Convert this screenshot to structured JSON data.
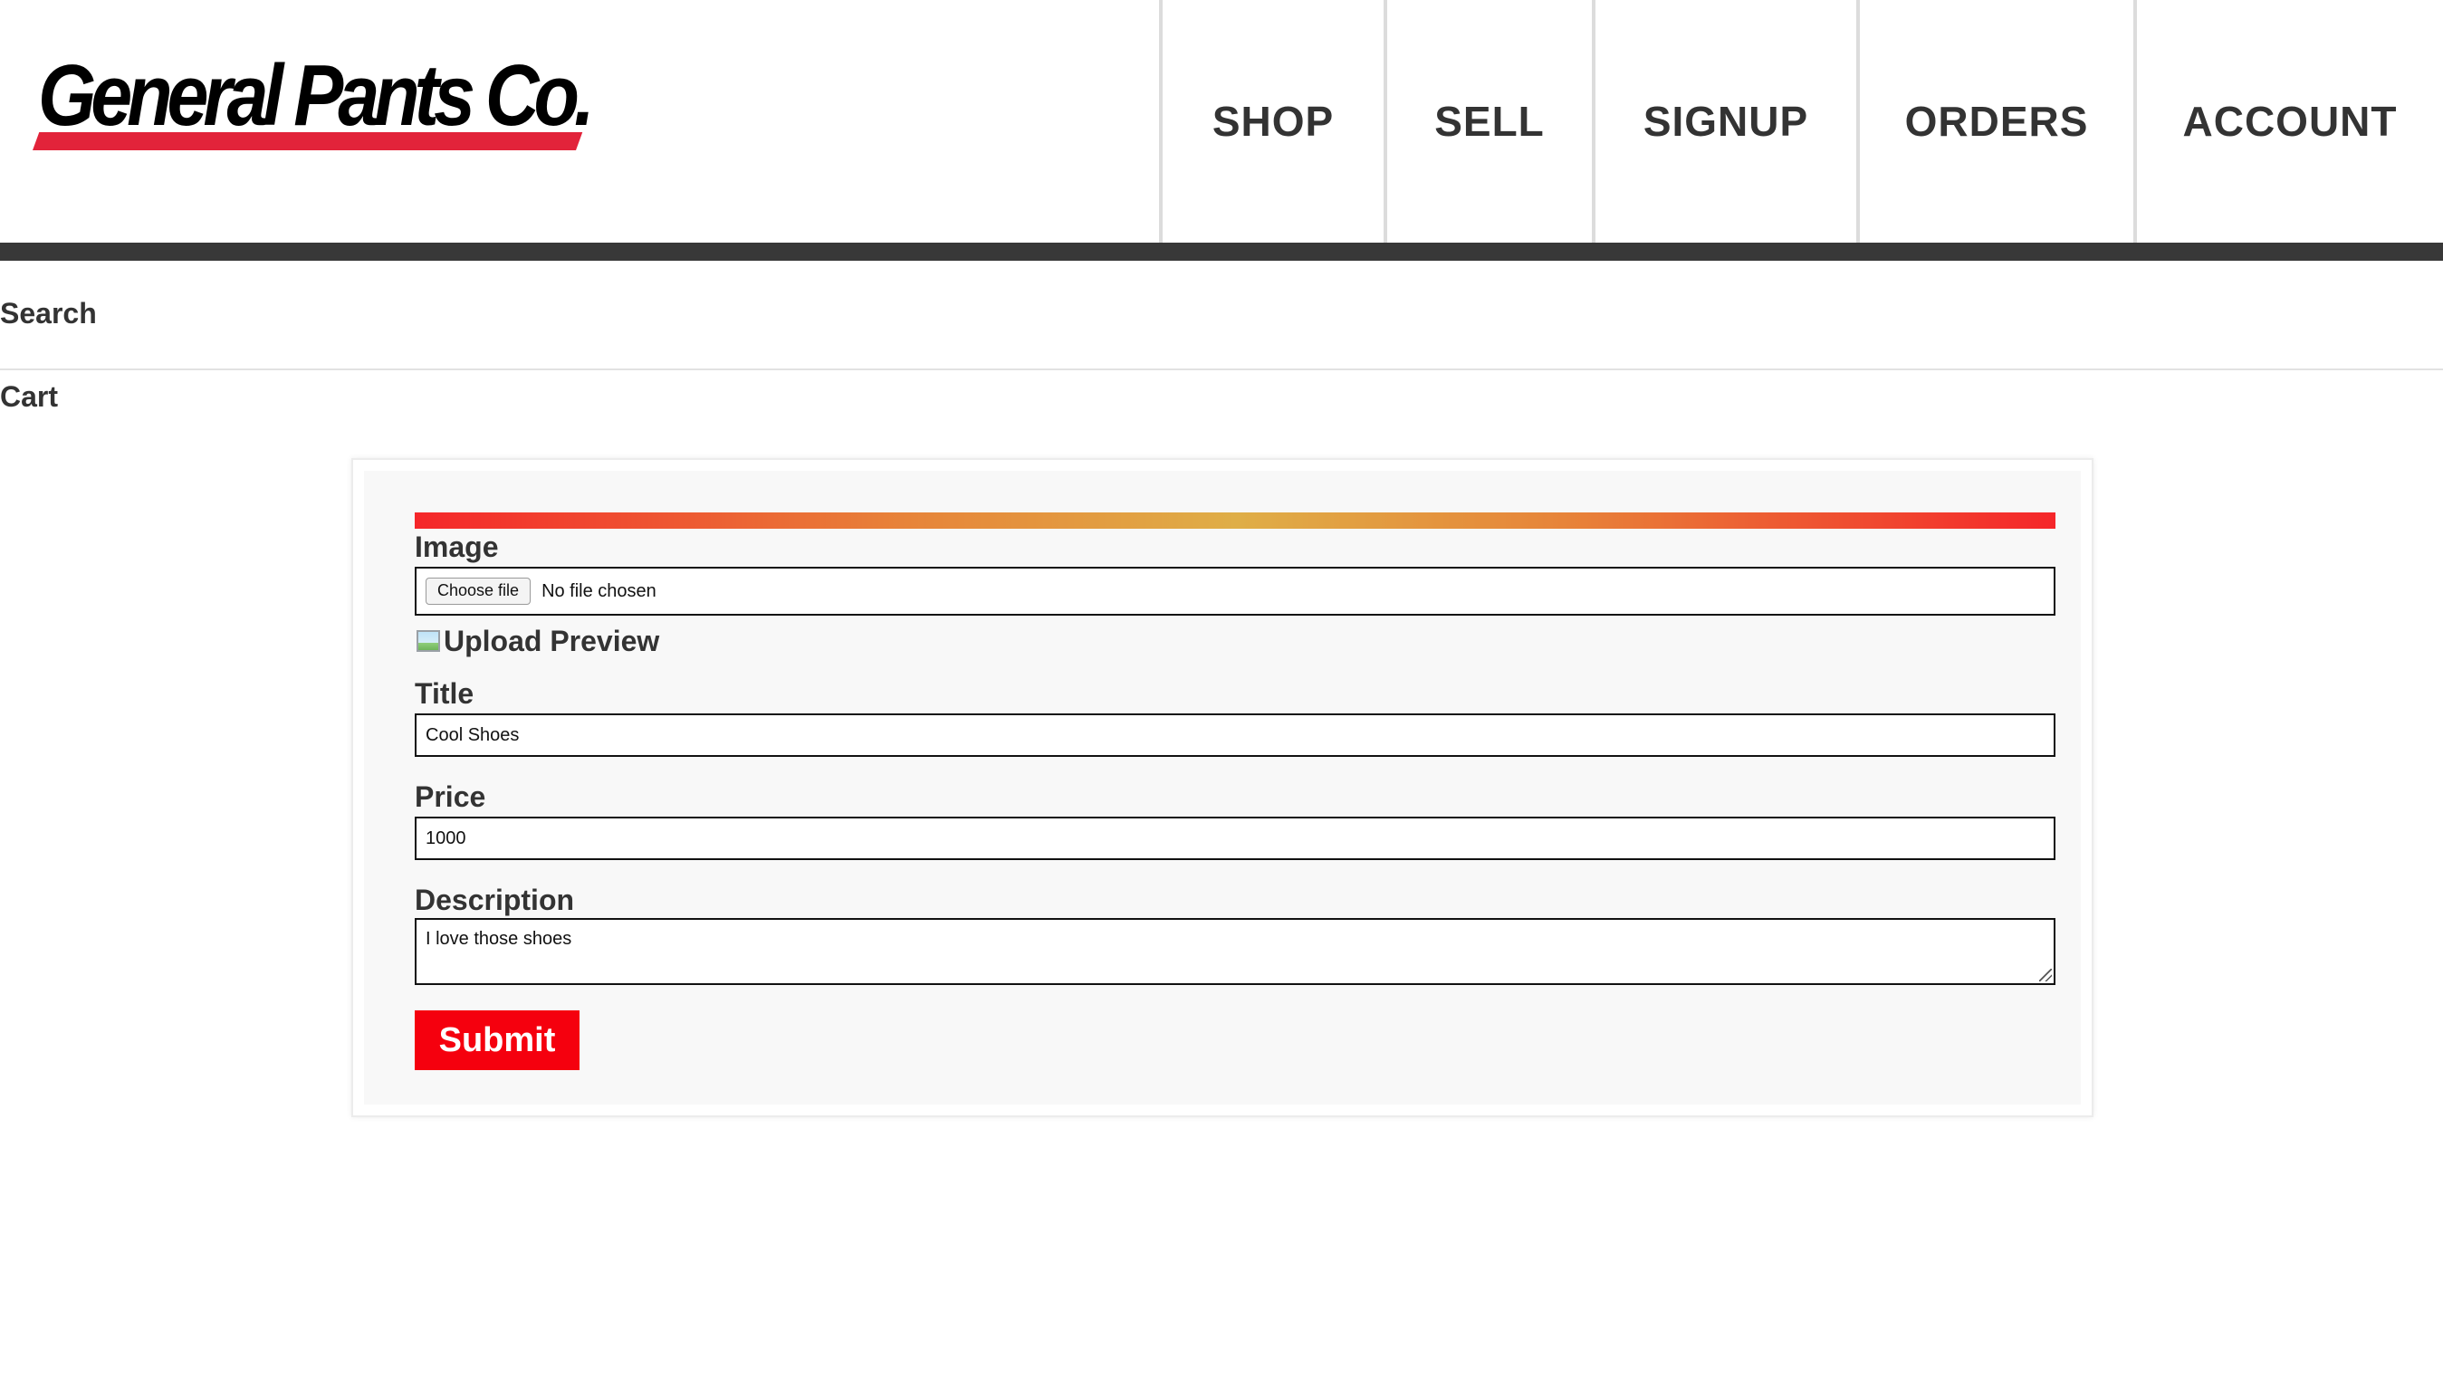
{
  "header": {
    "logo_text": "General Pants Co.",
    "nav": [
      "SHOP",
      "SELL",
      "SIGNUP",
      "ORDERS",
      "ACCOUNT"
    ]
  },
  "subnav": {
    "search_label": "Search",
    "cart_label": "Cart"
  },
  "form": {
    "image_label": "Image",
    "file_button_label": "Choose file",
    "file_status": "No file chosen",
    "preview_alt": "Upload Preview",
    "title_label": "Title",
    "title_value": "Cool Shoes",
    "price_label": "Price",
    "price_value": "1000",
    "description_label": "Description",
    "description_value": "I love those shoes",
    "submit_label": "Submit"
  },
  "colors": {
    "accent_red": "#f5000e",
    "logo_red": "#e2233a",
    "header_bar": "#383838",
    "gradient": [
      "#f5262a",
      "#e78439",
      "#dfae47",
      "#e78439",
      "#f5262a"
    ]
  },
  "icons": {
    "preview": "broken-image-icon"
  }
}
